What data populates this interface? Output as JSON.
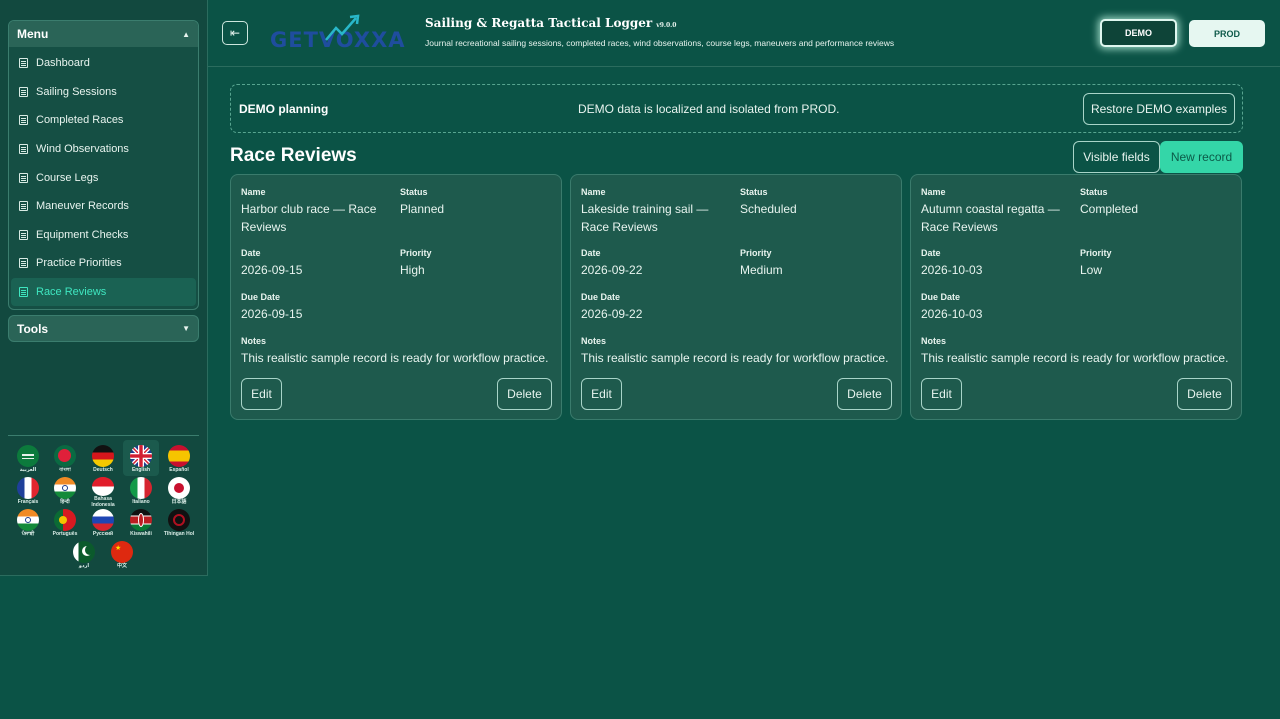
{
  "sidebar": {
    "menu_title": "Menu",
    "menu_items": [
      {
        "label": "Dashboard"
      },
      {
        "label": "Sailing Sessions"
      },
      {
        "label": "Completed Races"
      },
      {
        "label": "Wind Observations"
      },
      {
        "label": "Course Legs"
      },
      {
        "label": "Maneuver Records"
      },
      {
        "label": "Equipment Checks"
      },
      {
        "label": "Practice Priorities"
      },
      {
        "label": "Race Reviews",
        "active": true
      }
    ],
    "tools_title": "Tools",
    "languages": [
      {
        "label": "العربية",
        "icon": "saudi-flag-icon"
      },
      {
        "label": "বাংলা",
        "icon": "bangladesh-flag-icon"
      },
      {
        "label": "Deutsch",
        "icon": "germany-flag-icon"
      },
      {
        "label": "English",
        "icon": "uk-flag-icon",
        "selected": true
      },
      {
        "label": "Español",
        "icon": "spain-flag-icon"
      },
      {
        "label": "Français",
        "icon": "france-flag-icon"
      },
      {
        "label": "हिन्दी",
        "icon": "india-flag-icon"
      },
      {
        "label": "Bahasa Indonesia",
        "icon": "indonesia-flag-icon"
      },
      {
        "label": "Italiano",
        "icon": "italy-flag-icon"
      },
      {
        "label": "日本語",
        "icon": "japan-flag-icon"
      },
      {
        "label": "ਪੰਜਾਬੀ",
        "icon": "india-flag-icon"
      },
      {
        "label": "Português",
        "icon": "portugal-flag-icon"
      },
      {
        "label": "Русский",
        "icon": "russia-flag-icon"
      },
      {
        "label": "Kiswahili",
        "icon": "kenya-flag-icon"
      },
      {
        "label": "Tlhingan Hol",
        "icon": "klingon-flag-icon"
      },
      {
        "label": "اردو",
        "icon": "pakistan-flag-icon"
      },
      {
        "label": "中文",
        "icon": "china-flag-icon"
      }
    ]
  },
  "header": {
    "logo_text": "GETVOXXA",
    "title": "Sailing & Regatta Tactical Logger",
    "version": "v9.0.0",
    "subtitle": "Journal recreational sailing sessions, completed races, wind observations, course legs, maneuvers and performance reviews",
    "env_demo": "DEMO",
    "env_prod": "PROD"
  },
  "banner": {
    "title": "DEMO planning",
    "message": "DEMO data is localized and isolated from PROD.",
    "restore_label": "Restore DEMO examples"
  },
  "main": {
    "title": "Race Reviews",
    "visible_fields_label": "Visible fields",
    "new_record_label": "New record",
    "field_labels": {
      "name": "Name",
      "status": "Status",
      "date": "Date",
      "priority": "Priority",
      "due_date": "Due Date",
      "notes": "Notes"
    },
    "edit_label": "Edit",
    "delete_label": "Delete",
    "records": [
      {
        "name": "Harbor club race — Race Reviews",
        "status": "Planned",
        "date": "2026-09-15",
        "priority": "High",
        "due_date": "2026-09-15",
        "notes": "This realistic sample record is ready for workflow practice."
      },
      {
        "name": "Lakeside training sail — Race Reviews",
        "status": "Scheduled",
        "date": "2026-09-22",
        "priority": "Medium",
        "due_date": "2026-09-22",
        "notes": "This realistic sample record is ready for workflow practice."
      },
      {
        "name": "Autumn coastal regatta — Race Reviews",
        "status": "Completed",
        "date": "2026-10-03",
        "priority": "Low",
        "due_date": "2026-10-03",
        "notes": "This realistic sample record is ready for workflow practice."
      }
    ]
  },
  "colors": {
    "background": "#0b5346",
    "sidebar": "#12493f",
    "card": "#1e5a4d",
    "accent": "#34d6a8",
    "active_text": "#3fe6c0"
  }
}
